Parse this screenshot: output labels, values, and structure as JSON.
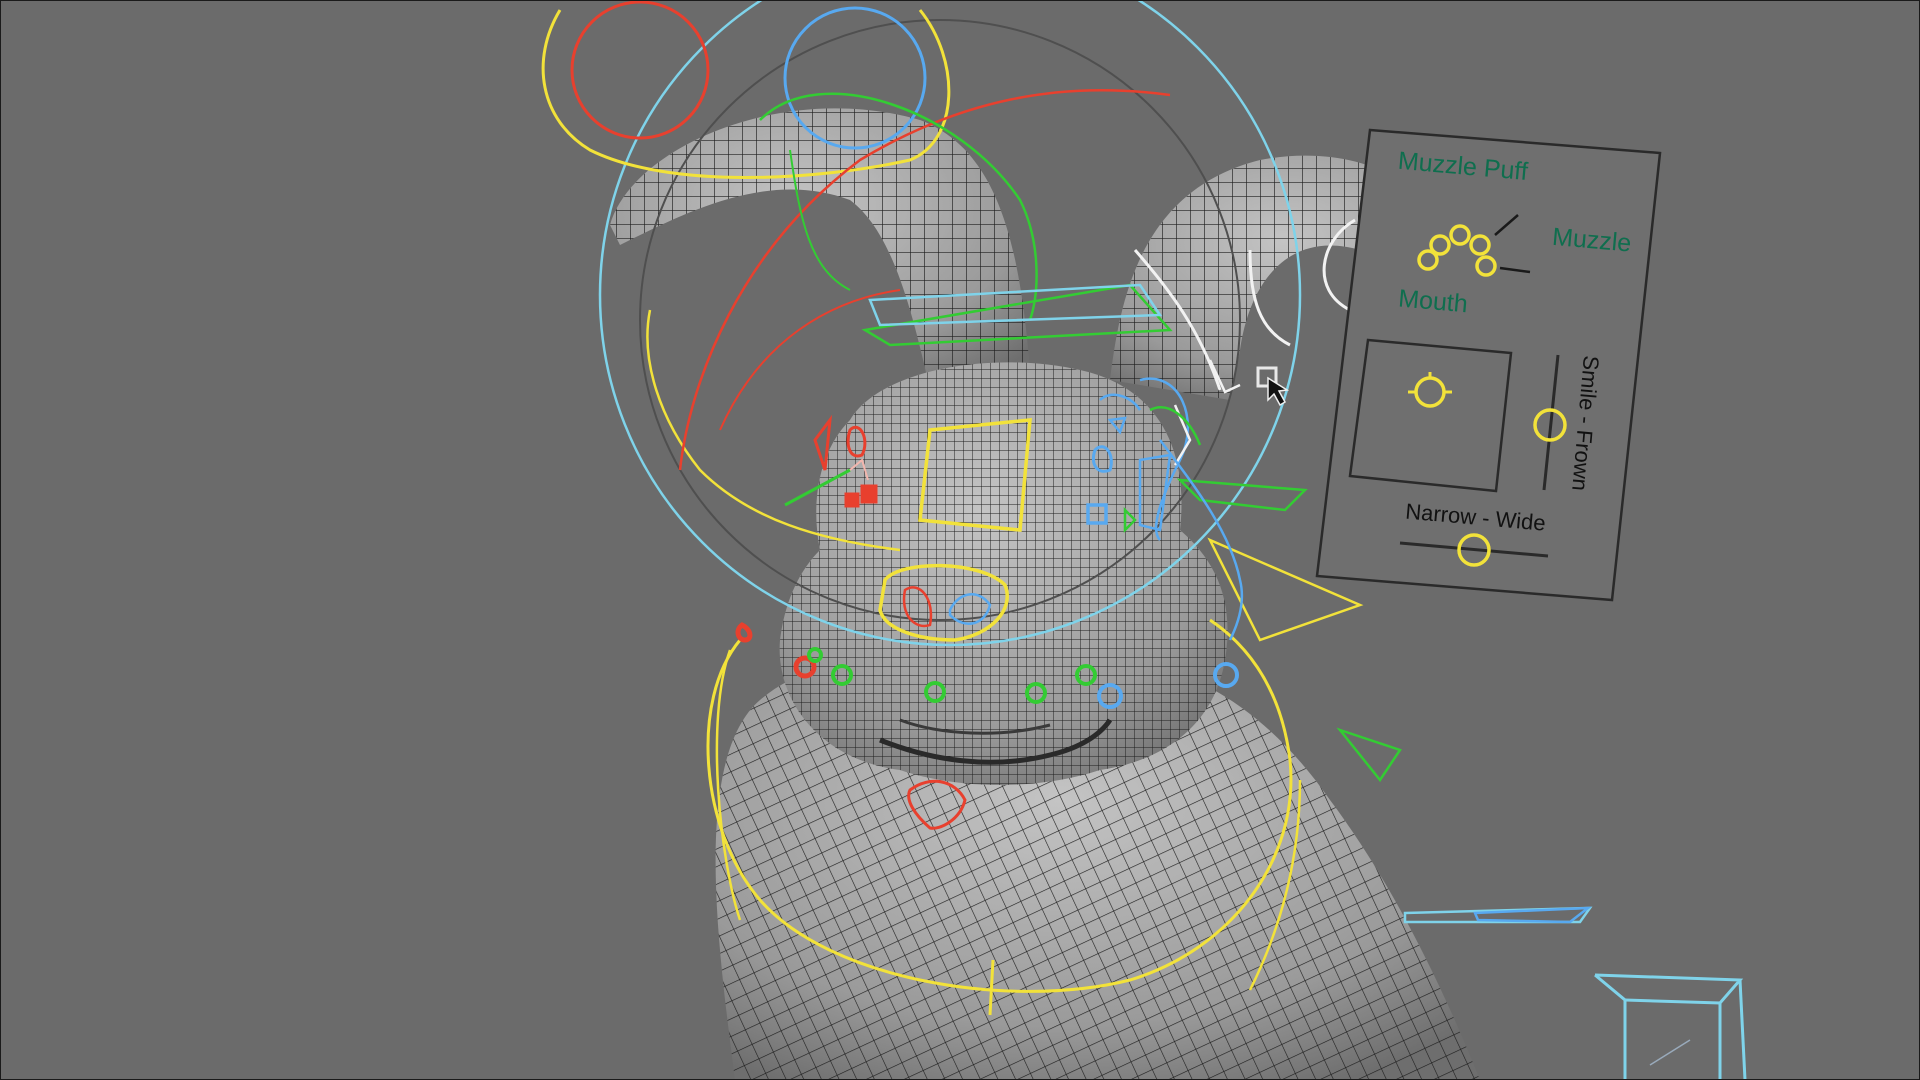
{
  "viewport": {
    "background": "#6b6b6b"
  },
  "face_panel": {
    "labels": {
      "muzzle_puff": "Muzzle Puff",
      "muzzle": "Muzzle",
      "mouth": "Mouth",
      "smile_frown": "Smile - Frown",
      "narrow_wide": "Narrow - Wide"
    }
  },
  "colors": {
    "mesh_fill": "#a9a9a9",
    "wire": "#1e1e1e",
    "ctrl_yellow": "#f2e23a",
    "ctrl_cyan": "#7fd3ea",
    "ctrl_blue": "#58a9f0",
    "ctrl_red": "#e8402e",
    "ctrl_green": "#33cc33",
    "ctrl_white": "#f2f2f2",
    "panel_text_green": "#0f6e4e"
  },
  "icons": {
    "cursor": "mouse-pointer-icon",
    "view_cube": "view-cube-icon"
  }
}
